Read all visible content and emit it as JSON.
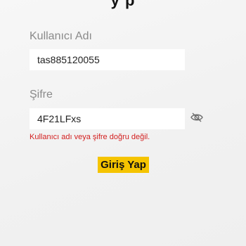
{
  "header": {
    "title_partial": "y p"
  },
  "login_form": {
    "username_label": "Kullanıcı Adı",
    "username_value": "tas885120055",
    "password_label": "Şifre",
    "password_value": "4F21LFxs",
    "password_toggle_icon": "eye-slash-icon",
    "error_message": "Kullanıcı adı veya şifre doğru değil.",
    "submit_label": "Giriş Yap"
  },
  "colors": {
    "accent": "#f5c400",
    "error": "#d32020",
    "label": "#8a8a8a"
  }
}
